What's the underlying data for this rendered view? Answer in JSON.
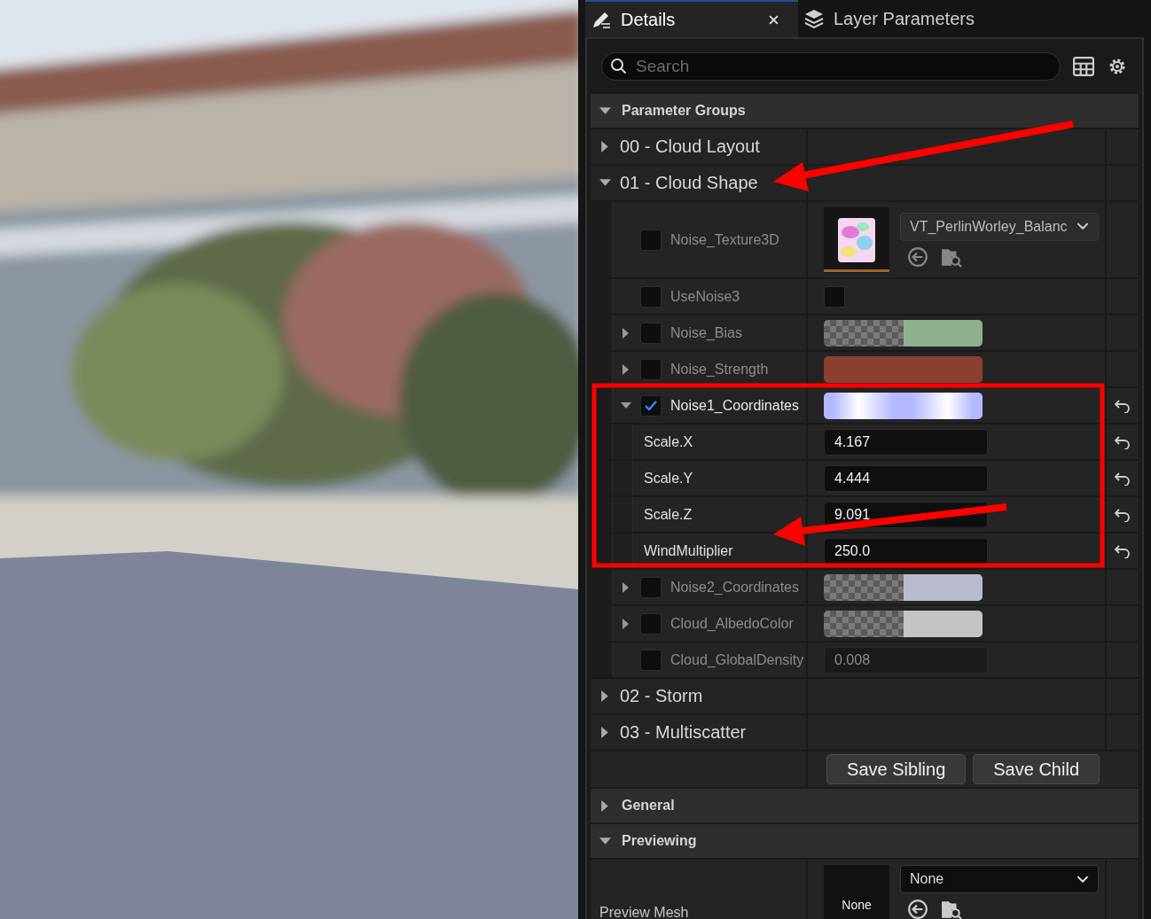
{
  "tabs": [
    {
      "label": "Details",
      "selected": true,
      "closable": true
    },
    {
      "label": "Layer Parameters",
      "selected": false,
      "closable": false
    }
  ],
  "search": {
    "placeholder": "Search"
  },
  "sections": [
    {
      "title": "Parameter Groups",
      "expanded": true,
      "groups": [
        {
          "label": "00 - Cloud Layout",
          "expanded": false
        },
        {
          "label": "01 - Cloud Shape",
          "expanded": true,
          "params": [
            {
              "name": "Noise_Texture3D",
              "kind": "texture",
              "enabled": false,
              "value": "VT_PerlinWorley_Balanc"
            },
            {
              "name": "UseNoise3",
              "kind": "bool",
              "enabled": false,
              "checked": false
            },
            {
              "name": "Noise_Bias",
              "kind": "color",
              "enabled": false,
              "color": "#8fb08f",
              "translucent": true,
              "expanded": false
            },
            {
              "name": "Noise_Strength",
              "kind": "color",
              "enabled": false,
              "color": "#8a3f30",
              "translucent": false,
              "expanded": false
            },
            {
              "name": "Noise1_Coordinates",
              "kind": "vector",
              "enabled": true,
              "color": "#b4b8ff",
              "expanded": true,
              "modified": true,
              "children": [
                {
                  "name": "Scale.X",
                  "value": "4.167",
                  "modified": true
                },
                {
                  "name": "Scale.Y",
                  "value": "4.444",
                  "modified": true
                },
                {
                  "name": "Scale.Z",
                  "value": "9.091",
                  "modified": true
                },
                {
                  "name": "WindMultiplier",
                  "value": "250.0",
                  "modified": true
                }
              ]
            },
            {
              "name": "Noise2_Coordinates",
              "kind": "color",
              "enabled": false,
              "color": "#b8bccc",
              "translucent": true,
              "expanded": false
            },
            {
              "name": "Cloud_AlbedoColor",
              "kind": "color",
              "enabled": false,
              "color": "#c4c4c4",
              "translucent": true,
              "expanded": false
            },
            {
              "name": "Cloud_GlobalDensity",
              "kind": "number",
              "enabled": false,
              "value": "0.008"
            }
          ]
        },
        {
          "label": "02 - Storm",
          "expanded": false
        },
        {
          "label": "03 - Multiscatter",
          "expanded": false
        }
      ],
      "buttons": [
        "Save Sibling",
        "Save Child"
      ]
    },
    {
      "title": "General",
      "expanded": false
    },
    {
      "title": "Previewing",
      "expanded": true,
      "properties": [
        {
          "label": "Preview Mesh",
          "thumbnail": "None",
          "value": "None"
        }
      ]
    }
  ]
}
